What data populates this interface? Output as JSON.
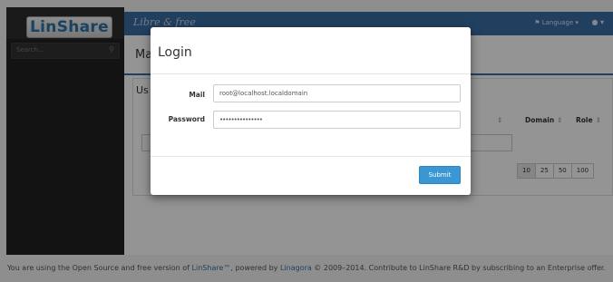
{
  "app": {
    "logo_text": "LinShare",
    "tagline": "Libre & free",
    "language_menu": "Language",
    "search_placeholder": "Search..."
  },
  "background": {
    "page_title": "Ma",
    "panel_title": "Us",
    "columns": [
      {
        "label": "",
        "sort": "⇕"
      },
      {
        "label": "Domain",
        "sort": "⇕"
      },
      {
        "label": "Role",
        "sort": "⇕"
      }
    ],
    "page_sizes": [
      "10",
      "25",
      "50",
      "100"
    ],
    "active_page_size": "10"
  },
  "modal": {
    "title": "Login",
    "mail_label": "Mail",
    "mail_value": "root@localhost.localdomain",
    "password_label": "Password",
    "password_value": "•••••••••••••••",
    "submit_label": "Submit"
  },
  "footer": {
    "text_before": "You are using the Open Source and free version of ",
    "linshare_link": "LinShare™",
    "text_middle": ", powered by ",
    "linagora_link": "Linagora",
    "text_after": " © 2009–2014. Contribute to LinShare R&D by subscribing to an Enterprise offer."
  },
  "colors": {
    "accent": "#3a6fa6",
    "submit": "#3b97d3",
    "sidebar": "#222222"
  },
  "icons": {
    "search": "search-icon",
    "user": "user-icon",
    "flag": "flag-icon",
    "caret": "caret-down-icon"
  }
}
